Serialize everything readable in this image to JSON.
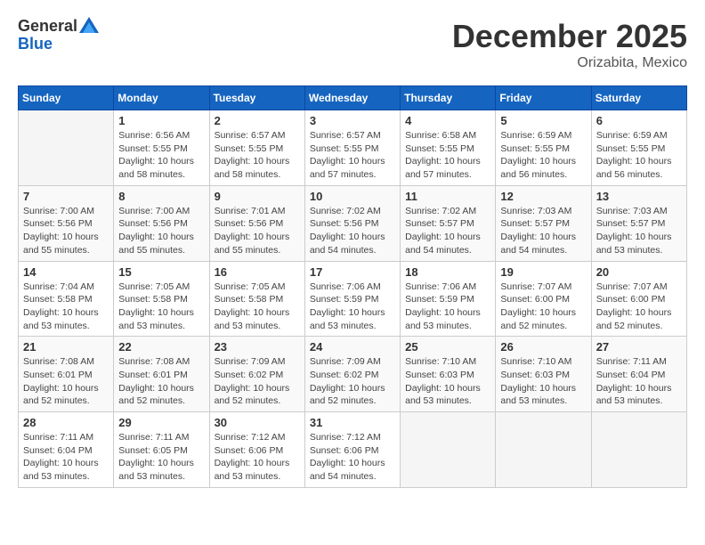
{
  "header": {
    "logo_general": "General",
    "logo_blue": "Blue",
    "month_year": "December 2025",
    "location": "Orizabita, Mexico"
  },
  "weekdays": [
    "Sunday",
    "Monday",
    "Tuesday",
    "Wednesday",
    "Thursday",
    "Friday",
    "Saturday"
  ],
  "weeks": [
    [
      {
        "day": "",
        "info": ""
      },
      {
        "day": "1",
        "info": "Sunrise: 6:56 AM\nSunset: 5:55 PM\nDaylight: 10 hours\nand 58 minutes."
      },
      {
        "day": "2",
        "info": "Sunrise: 6:57 AM\nSunset: 5:55 PM\nDaylight: 10 hours\nand 58 minutes."
      },
      {
        "day": "3",
        "info": "Sunrise: 6:57 AM\nSunset: 5:55 PM\nDaylight: 10 hours\nand 57 minutes."
      },
      {
        "day": "4",
        "info": "Sunrise: 6:58 AM\nSunset: 5:55 PM\nDaylight: 10 hours\nand 57 minutes."
      },
      {
        "day": "5",
        "info": "Sunrise: 6:59 AM\nSunset: 5:55 PM\nDaylight: 10 hours\nand 56 minutes."
      },
      {
        "day": "6",
        "info": "Sunrise: 6:59 AM\nSunset: 5:55 PM\nDaylight: 10 hours\nand 56 minutes."
      }
    ],
    [
      {
        "day": "7",
        "info": "Sunrise: 7:00 AM\nSunset: 5:56 PM\nDaylight: 10 hours\nand 55 minutes."
      },
      {
        "day": "8",
        "info": "Sunrise: 7:00 AM\nSunset: 5:56 PM\nDaylight: 10 hours\nand 55 minutes."
      },
      {
        "day": "9",
        "info": "Sunrise: 7:01 AM\nSunset: 5:56 PM\nDaylight: 10 hours\nand 55 minutes."
      },
      {
        "day": "10",
        "info": "Sunrise: 7:02 AM\nSunset: 5:56 PM\nDaylight: 10 hours\nand 54 minutes."
      },
      {
        "day": "11",
        "info": "Sunrise: 7:02 AM\nSunset: 5:57 PM\nDaylight: 10 hours\nand 54 minutes."
      },
      {
        "day": "12",
        "info": "Sunrise: 7:03 AM\nSunset: 5:57 PM\nDaylight: 10 hours\nand 54 minutes."
      },
      {
        "day": "13",
        "info": "Sunrise: 7:03 AM\nSunset: 5:57 PM\nDaylight: 10 hours\nand 53 minutes."
      }
    ],
    [
      {
        "day": "14",
        "info": "Sunrise: 7:04 AM\nSunset: 5:58 PM\nDaylight: 10 hours\nand 53 minutes."
      },
      {
        "day": "15",
        "info": "Sunrise: 7:05 AM\nSunset: 5:58 PM\nDaylight: 10 hours\nand 53 minutes."
      },
      {
        "day": "16",
        "info": "Sunrise: 7:05 AM\nSunset: 5:58 PM\nDaylight: 10 hours\nand 53 minutes."
      },
      {
        "day": "17",
        "info": "Sunrise: 7:06 AM\nSunset: 5:59 PM\nDaylight: 10 hours\nand 53 minutes."
      },
      {
        "day": "18",
        "info": "Sunrise: 7:06 AM\nSunset: 5:59 PM\nDaylight: 10 hours\nand 53 minutes."
      },
      {
        "day": "19",
        "info": "Sunrise: 7:07 AM\nSunset: 6:00 PM\nDaylight: 10 hours\nand 52 minutes."
      },
      {
        "day": "20",
        "info": "Sunrise: 7:07 AM\nSunset: 6:00 PM\nDaylight: 10 hours\nand 52 minutes."
      }
    ],
    [
      {
        "day": "21",
        "info": "Sunrise: 7:08 AM\nSunset: 6:01 PM\nDaylight: 10 hours\nand 52 minutes."
      },
      {
        "day": "22",
        "info": "Sunrise: 7:08 AM\nSunset: 6:01 PM\nDaylight: 10 hours\nand 52 minutes."
      },
      {
        "day": "23",
        "info": "Sunrise: 7:09 AM\nSunset: 6:02 PM\nDaylight: 10 hours\nand 52 minutes."
      },
      {
        "day": "24",
        "info": "Sunrise: 7:09 AM\nSunset: 6:02 PM\nDaylight: 10 hours\nand 52 minutes."
      },
      {
        "day": "25",
        "info": "Sunrise: 7:10 AM\nSunset: 6:03 PM\nDaylight: 10 hours\nand 53 minutes."
      },
      {
        "day": "26",
        "info": "Sunrise: 7:10 AM\nSunset: 6:03 PM\nDaylight: 10 hours\nand 53 minutes."
      },
      {
        "day": "27",
        "info": "Sunrise: 7:11 AM\nSunset: 6:04 PM\nDaylight: 10 hours\nand 53 minutes."
      }
    ],
    [
      {
        "day": "28",
        "info": "Sunrise: 7:11 AM\nSunset: 6:04 PM\nDaylight: 10 hours\nand 53 minutes."
      },
      {
        "day": "29",
        "info": "Sunrise: 7:11 AM\nSunset: 6:05 PM\nDaylight: 10 hours\nand 53 minutes."
      },
      {
        "day": "30",
        "info": "Sunrise: 7:12 AM\nSunset: 6:06 PM\nDaylight: 10 hours\nand 53 minutes."
      },
      {
        "day": "31",
        "info": "Sunrise: 7:12 AM\nSunset: 6:06 PM\nDaylight: 10 hours\nand 54 minutes."
      },
      {
        "day": "",
        "info": ""
      },
      {
        "day": "",
        "info": ""
      },
      {
        "day": "",
        "info": ""
      }
    ]
  ]
}
